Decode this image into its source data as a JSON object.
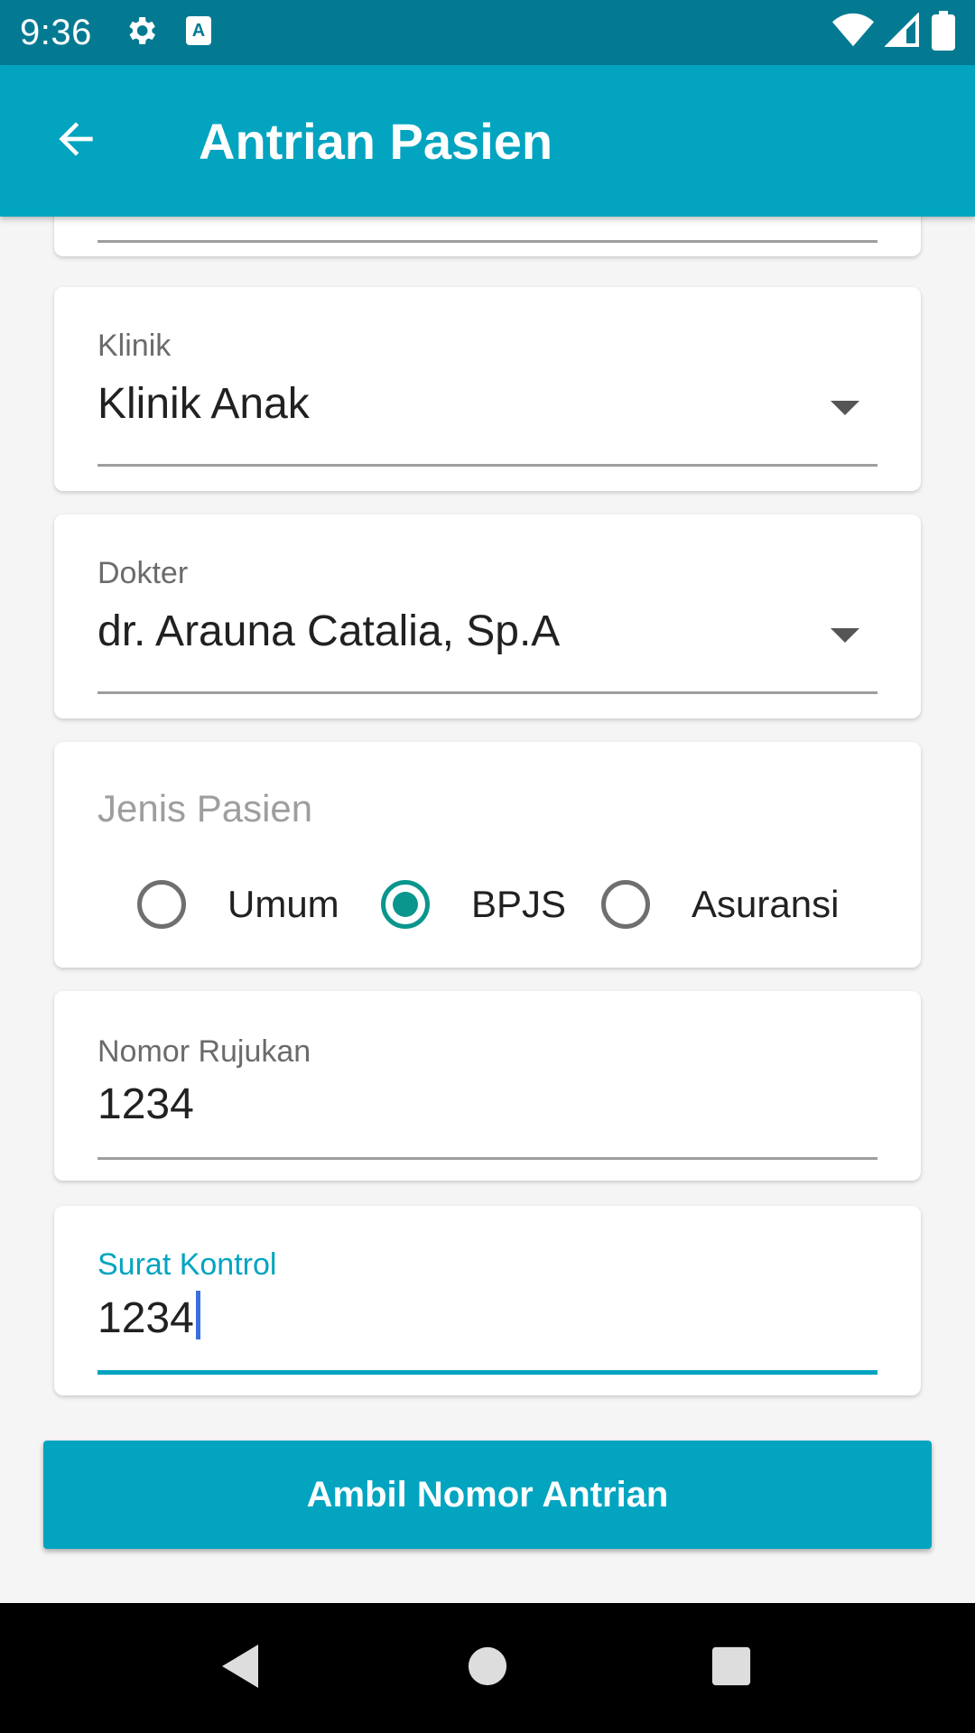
{
  "status_bar": {
    "time": "9:36",
    "icons_left": [
      "settings-gear-icon",
      "keyboard-a-icon"
    ],
    "icons_right": [
      "wifi-icon",
      "cell-signal-icon",
      "battery-icon"
    ]
  },
  "app_bar": {
    "title": "Antrian Pasien",
    "back_icon": "arrow-back-icon"
  },
  "form": {
    "klinik": {
      "label": "Klinik",
      "value": "Klinik Anak"
    },
    "dokter": {
      "label": "Dokter",
      "value": "dr. Arauna Catalia, Sp.A"
    },
    "jenis_pasien": {
      "label": "Jenis Pasien",
      "options": [
        "Umum",
        "BPJS",
        "Asuransi"
      ],
      "selected": "BPJS"
    },
    "nomor_rujukan": {
      "label": "Nomor Rujukan",
      "value": "1234"
    },
    "surat_kontrol": {
      "label": "Surat Kontrol",
      "value": "1234"
    }
  },
  "submit_label": "Ambil Nomor Antrian",
  "colors": {
    "status_bar": "#047a92",
    "app_bar": "#02a4c0",
    "accent_teal": "#0a968d",
    "focus": "#02a4c0"
  },
  "nav_bar": {
    "icons": [
      "nav-back-icon",
      "nav-home-icon",
      "nav-recents-icon"
    ]
  }
}
